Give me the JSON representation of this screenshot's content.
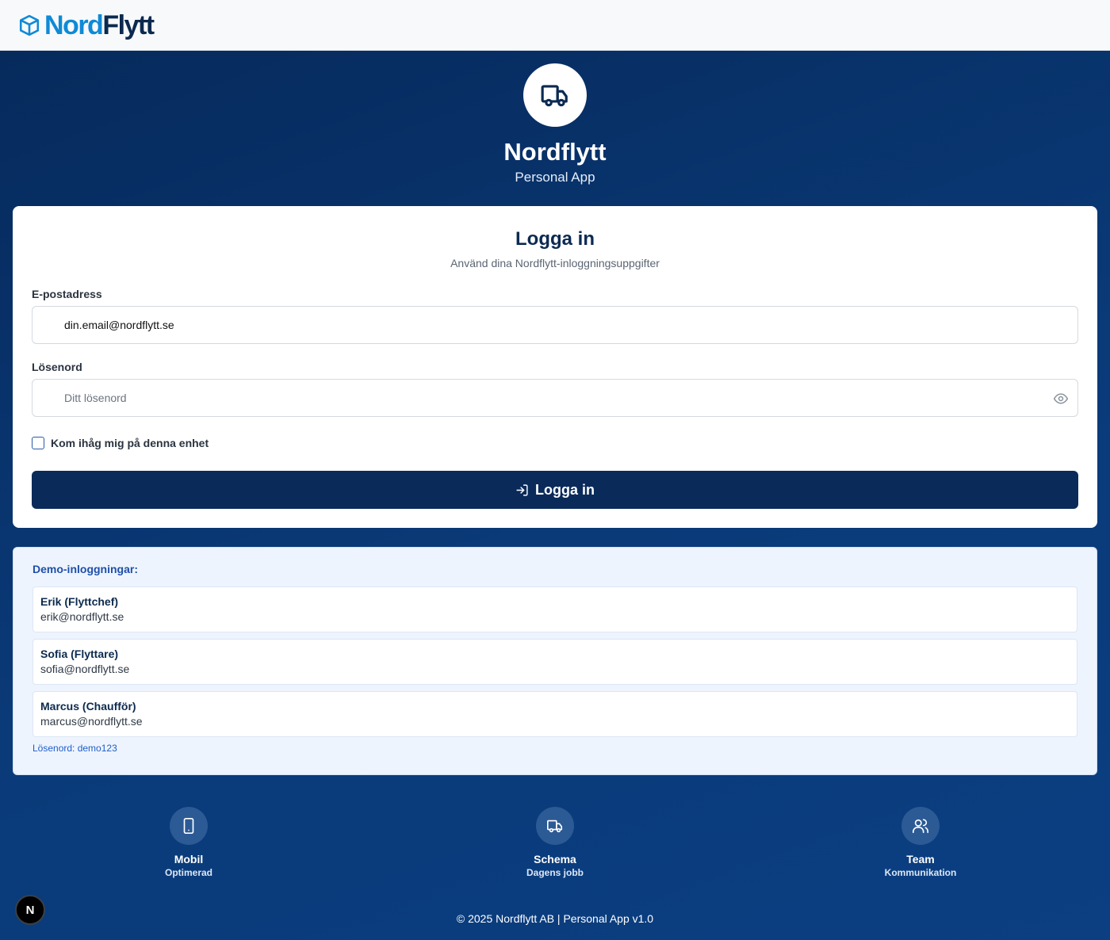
{
  "brand": {
    "name_part1": "Nord",
    "name_part2": "Flytt",
    "logo_icon": "box-icon"
  },
  "hero": {
    "icon": "truck-icon",
    "title": "Nordflytt",
    "subtitle": "Personal App"
  },
  "login": {
    "title": "Logga in",
    "subtitle": "Använd dina Nordflytt-inloggningsuppgifter",
    "email_label": "E-postadress",
    "email_value": "din.email@nordflytt.se",
    "password_label": "Lösenord",
    "password_placeholder": "Ditt lösenord",
    "remember_label": "Kom ihåg mig på denna enhet",
    "remember_checked": false,
    "submit_label": "Logga in"
  },
  "demo": {
    "title": "Demo-inloggningar:",
    "accounts": [
      {
        "name": "Erik (Flyttchef)",
        "email": "erik@nordflytt.se"
      },
      {
        "name": "Sofia (Flyttare)",
        "email": "sofia@nordflytt.se"
      },
      {
        "name": "Marcus (Chaufför)",
        "email": "marcus@nordflytt.se"
      }
    ],
    "password_note": "Lösenord: demo123"
  },
  "features": [
    {
      "icon": "smartphone-icon",
      "title": "Mobil",
      "subtitle": "Optimerad"
    },
    {
      "icon": "truck-icon",
      "title": "Schema",
      "subtitle": "Dagens jobb"
    },
    {
      "icon": "users-icon",
      "title": "Team",
      "subtitle": "Kommunikation"
    }
  ],
  "footer": {
    "text": "© 2025 Nordflytt AB | Personal App v1.0"
  },
  "dev_badge": {
    "label": "N"
  },
  "colors": {
    "primary": "#0a2a5a",
    "accent": "#0f8ad6",
    "background": "#0a3a78"
  }
}
